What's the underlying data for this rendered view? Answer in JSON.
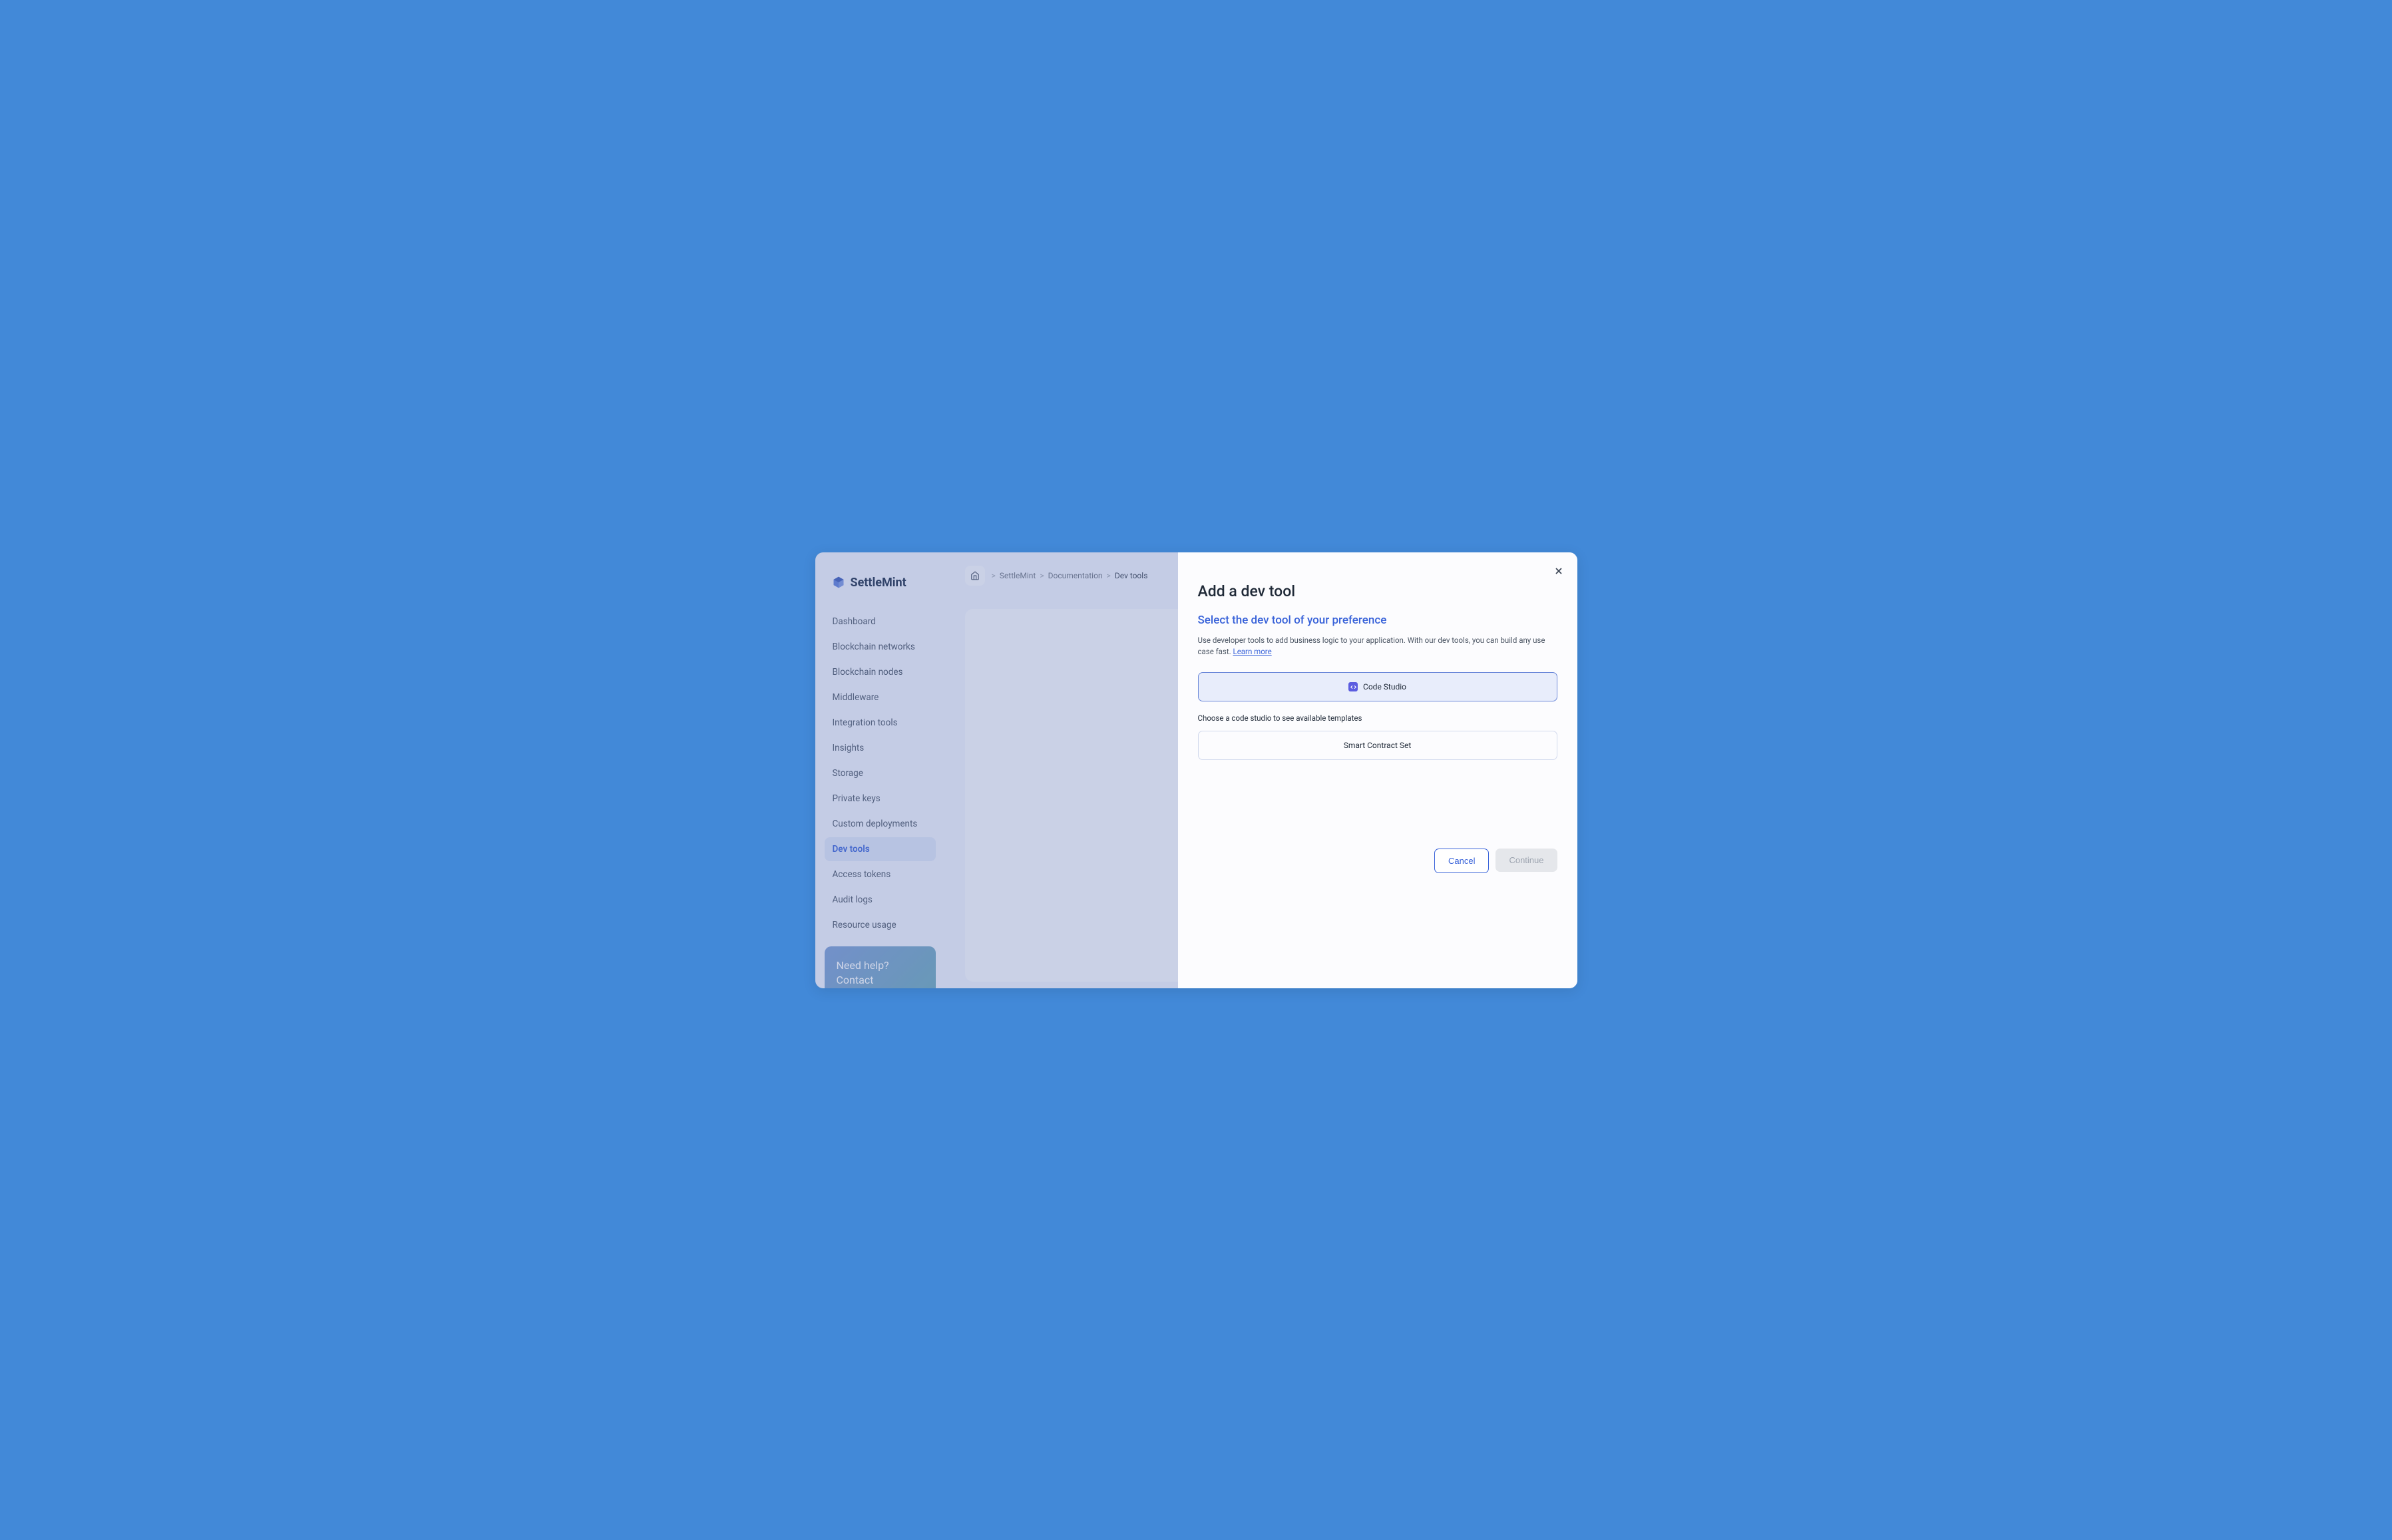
{
  "logo": {
    "text": "SettleMint"
  },
  "sidebar": {
    "items": [
      {
        "label": "Dashboard"
      },
      {
        "label": "Blockchain networks"
      },
      {
        "label": "Blockchain nodes"
      },
      {
        "label": "Middleware"
      },
      {
        "label": "Integration tools"
      },
      {
        "label": "Insights"
      },
      {
        "label": "Storage"
      },
      {
        "label": "Private keys"
      },
      {
        "label": "Custom deployments"
      },
      {
        "label": "Dev tools"
      },
      {
        "label": "Access tokens"
      },
      {
        "label": "Audit logs"
      },
      {
        "label": "Resource usage"
      }
    ],
    "help": {
      "line1": "Need help?",
      "line2": "Contact"
    }
  },
  "breadcrumb": {
    "items": [
      {
        "label": "SettleMint"
      },
      {
        "label": "Documentation"
      },
      {
        "label": "Dev tools"
      }
    ]
  },
  "content": {
    "desc": "Use developer tools to add busine"
  },
  "modal": {
    "title": "Add a dev tool",
    "subtitle": "Select the dev tool of your preference",
    "desc": "Use developer tools to add business logic to your application. With our dev tools, you can build any use case fast.  ",
    "learn_more": "Learn more",
    "option_label": "Code Studio",
    "section_label": "Choose a code studio to see available templates",
    "template_label": "Smart Contract Set",
    "cancel": "Cancel",
    "continue": "Continue"
  }
}
